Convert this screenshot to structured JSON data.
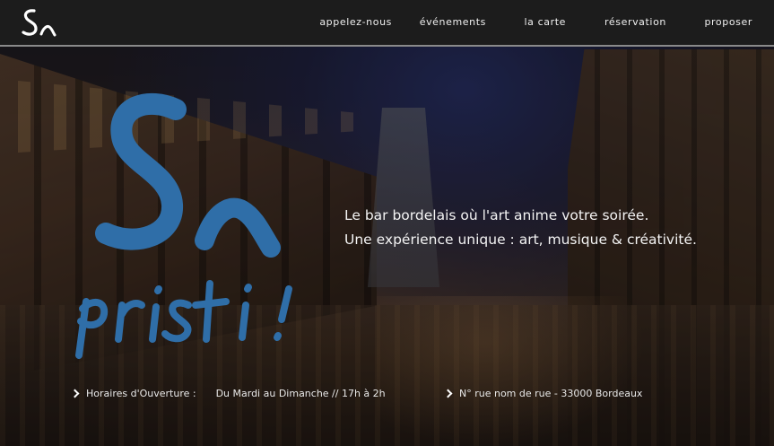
{
  "brand": {
    "logo_small_text": "Sn",
    "logo_big_top": "Sn",
    "logo_big_bottom": "pristi!",
    "accent_color": "#2f6ea8"
  },
  "nav": {
    "items": [
      {
        "label": "appelez-nous"
      },
      {
        "label": "événements"
      },
      {
        "label": "la carte"
      },
      {
        "label": "réservation"
      },
      {
        "label": "proposer"
      }
    ]
  },
  "hero": {
    "tagline_line1": "Le bar bordelais où l'art anime votre soirée.",
    "tagline_line2": "Une expérience unique : art, musique & créativité."
  },
  "info": {
    "hours_label": "Horaires d'Ouverture :",
    "hours_value": "Du Mardi au Dimanche // 17h à 2h",
    "address": "N° rue nom de rue - 33000 Bordeaux",
    "icon": "chevron-right-icon"
  }
}
